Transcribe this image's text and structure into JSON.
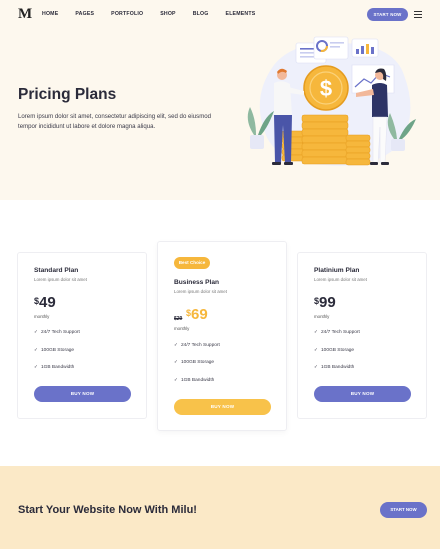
{
  "brand": {
    "logo_letter": "M",
    "accent": "#6a72c9",
    "yellow": "#f6b73c"
  },
  "nav": {
    "items": [
      "HOME",
      "PAGES",
      "PORTFOLIO",
      "SHOP",
      "BLOG",
      "ELEMENTS"
    ],
    "cta_label": "START NOW",
    "menu_icon": "hamburger-icon"
  },
  "hero": {
    "title": "Pricing Plans",
    "text": "Lorem ipsum dolor sit amet, consectetur adipiscing elit, sed do eiusmod tempor incididunt ut labore et dolore magna aliqua."
  },
  "plans": [
    {
      "name": "Standard Plan",
      "desc": "Lorem ipsum dolor sit amet",
      "currency": "$",
      "price": "49",
      "period": "monthly",
      "features": [
        "24/7 Tech Support",
        "100GB Storage",
        "1GB Bandwidth"
      ],
      "button": "BUY NOW"
    },
    {
      "badge": "Best Choice",
      "name": "Business Plan",
      "desc": "Lorem ipsum dolor sit amet",
      "old_price": "$29",
      "currency": "$",
      "price": "69",
      "period": "monthly",
      "features": [
        "24/7 Tech Support",
        "100GB Storage",
        "1GB Bandwidth"
      ],
      "button": "BUY NOW"
    },
    {
      "name": "Platinium Plan",
      "desc": "Lorem ipsum dolor sit amet",
      "currency": "$",
      "price": "99",
      "period": "monthly",
      "features": [
        "24/7 Tech Support",
        "100GB Storage",
        "1GB Bandwidth"
      ],
      "button": "BUY NOW"
    }
  ],
  "cta": {
    "title": "Start Your Website Now With Milu!",
    "button": "START NOW"
  }
}
